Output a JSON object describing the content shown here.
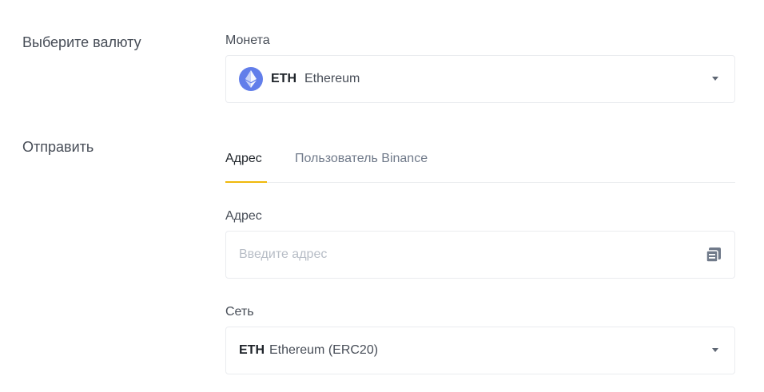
{
  "sections": {
    "currency_label": "Выберите валюту",
    "send_label": "Отправить"
  },
  "coin": {
    "label": "Монета",
    "symbol": "ETH",
    "name": "Ethereum",
    "icon": "ethereum-icon",
    "icon_color": "#627eea"
  },
  "tabs": [
    {
      "label": "Адрес",
      "active": true
    },
    {
      "label": "Пользователь Binance",
      "active": false
    }
  ],
  "address": {
    "label": "Адрес",
    "placeholder": "Введите адрес",
    "value": "",
    "icon": "paste-icon"
  },
  "network": {
    "label": "Сеть",
    "symbol": "ETH",
    "name": "Ethereum (ERC20)"
  },
  "colors": {
    "accent": "#f0b90b",
    "text_primary": "#1e2329",
    "text_secondary": "#474d57",
    "text_muted": "#707a8a",
    "border": "#eaecef",
    "placeholder": "#b7bdc6"
  }
}
